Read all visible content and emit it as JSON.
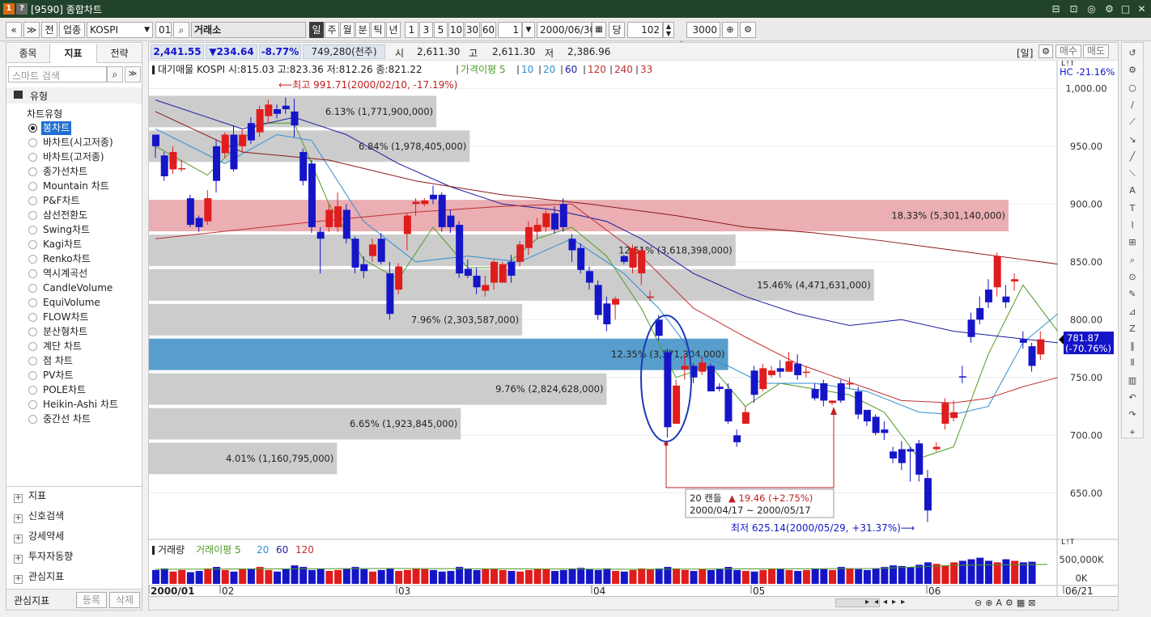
{
  "window": {
    "badge1": "1",
    "badge2": "?",
    "title": "[9590] 종합차트",
    "buttons": [
      "⊟",
      "⊡",
      "◎",
      "⚙",
      "□",
      "✕"
    ]
  },
  "toolbar": {
    "nav_prev": "«",
    "nav_down": "≫",
    "btn_prev": "전",
    "btn_industry": "업종",
    "symbol": "KOSPI",
    "code": "01",
    "market": "거래소",
    "periods": [
      "일",
      "주",
      "월",
      "분",
      "틱",
      "년"
    ],
    "active_period": "일",
    "intervals": [
      "1",
      "3",
      "5",
      "10",
      "30",
      "60"
    ],
    "count": "1",
    "date": "2000/06/30",
    "btn_dang": "당",
    "bars": "102",
    "slash": "/",
    "total": "3000"
  },
  "sidebar": {
    "tabs": [
      "종목",
      "지표",
      "전략"
    ],
    "active_tab": "지표",
    "search_placeholder": "스마트 검색",
    "group_title": "유형",
    "tree_title": "차트유형",
    "chart_types": [
      "봉차트",
      "바차트(시고저종)",
      "바차트(고저종)",
      "종가선차트",
      "Mountain 차트",
      "P&F차트",
      "삼선전환도",
      "Swing차트",
      "Kagi차트",
      "Renko차트",
      "역시계곡선",
      "CandleVolume",
      "EquiVolume",
      "FLOW차트",
      "분산형차트",
      "계단 차트",
      "점 차트",
      "PV차트",
      "POLE차트",
      "Heikin-Ashi 차트",
      "중간선 차트"
    ],
    "selected_type": "봉차트",
    "groups": [
      "지표",
      "신호검색",
      "강세약세",
      "투자자동향",
      "관심지표"
    ],
    "footer_label": "관심지표",
    "footer_register": "등록",
    "footer_delete": "삭제"
  },
  "pricebar": {
    "price": "2,441.55",
    "change": "▼234.64",
    "pct": "-8.77%",
    "volume": "749,280(천주)",
    "open_label": "시",
    "open": "2,611.30",
    "high_label": "고",
    "high": "2,611.30",
    "low_label": "저",
    "low": "2,386.96",
    "period_label": "[일]",
    "buy": "매수",
    "sell": "매도"
  },
  "legend": {
    "text": "대기매물 KOSPI 시:815.03 고:823.36 저:812.26 종:821.22",
    "ma_label": "가격이평 5",
    "ma10": "10",
    "ma20": "20",
    "ma60": "60",
    "ma120": "120",
    "ma240": "240",
    "ma33": "33"
  },
  "volume_legend": {
    "label": "거래량",
    "ma_label": "거래이평 5",
    "ma20": "20",
    "ma60": "60",
    "ma120": "120"
  },
  "annotations": {
    "high": "최고 991.71(2000/02/10, -17.19%)",
    "low": "최저 625.14(2000/05/29, +31.37%)",
    "range_title": "20 캔들",
    "range_change": "▲ 19.46 (+2.75%)",
    "range_dates": "2000/04/17 ~ 2000/05/17",
    "hc": "HC -21.16%",
    "current_price": "781.87",
    "current_pct": "(-70.76%)",
    "vol_ticks": [
      "500,000K",
      "0K"
    ],
    "lit1": "L!T",
    "lit2": "L!T"
  },
  "colors": {
    "up": "#e01c1c",
    "down": "#1515c8",
    "ma5": "#4f9a25",
    "ma10": "#2e8fd0",
    "ma20": "#1a1aa0",
    "ma60": "#8a1a1a",
    "ma120": "#c03030",
    "volume_profile_gray": "#c8c8c8",
    "volume_profile_red": "#e6a0a6",
    "volume_profile_blue": "#4a96c8"
  },
  "chart_data": {
    "type": "candlestick",
    "title": "KOSPI",
    "ylim": [
      610,
      1010
    ],
    "y_ticks": [
      "1,000.00",
      "950.00",
      "900.00",
      "850.00",
      "800.00",
      "750.00",
      "700.00",
      "650.00"
    ],
    "y_tick_values": [
      1000,
      950,
      900,
      850,
      800,
      750,
      700,
      650
    ],
    "x_labels": [
      "2000/01",
      "02",
      "03",
      "04",
      "05",
      "06",
      "06/21"
    ],
    "volume_profile": [
      {
        "lo": 965,
        "hi": 995,
        "label": "6.13% (1,771,900,000)",
        "value": 6.13
      },
      {
        "lo": 935,
        "hi": 965,
        "label": "6.84% (1,978,405,000)",
        "value": 6.84
      },
      {
        "lo": 905,
        "hi": 935,
        "label": "",
        "value": 0
      },
      {
        "lo": 875,
        "hi": 905,
        "label": "18.33% (5,301,140,000)",
        "value": 18.33
      },
      {
        "lo": 845,
        "hi": 875,
        "label": "12.51% (3,618,398,000)",
        "value": 12.51
      },
      {
        "lo": 815,
        "hi": 845,
        "label": "15.46% (4,471,631,000)",
        "value": 15.46
      },
      {
        "lo": 785,
        "hi": 815,
        "label": "7.96% (2,303,587,000)",
        "value": 7.96
      },
      {
        "lo": 755,
        "hi": 785,
        "label": "12.35% (3,571,304,000)",
        "value": 12.35
      },
      {
        "lo": 725,
        "hi": 755,
        "label": "9.76% (2,824,628,000)",
        "value": 9.76
      },
      {
        "lo": 695,
        "hi": 725,
        "label": "6.65% (1,923,845,000)",
        "value": 6.65
      },
      {
        "lo": 665,
        "hi": 695,
        "label": "4.01% (1,160,795,000)",
        "value": 4.01
      }
    ],
    "candles": [
      [
        960,
        950,
        960,
        940
      ],
      [
        942,
        924,
        945,
        920
      ],
      [
        930,
        945,
        950,
        926
      ],
      [
        930,
        931,
        938,
        928
      ],
      [
        905,
        882,
        908,
        880
      ],
      [
        888,
        880,
        890,
        876
      ],
      [
        885,
        905,
        912,
        882
      ],
      [
        950,
        920,
        955,
        910
      ],
      [
        944,
        960,
        962,
        940
      ],
      [
        960,
        930,
        968,
        928
      ],
      [
        950,
        960,
        965,
        945
      ],
      [
        970,
        955,
        975,
        952
      ],
      [
        962,
        982,
        985,
        958
      ],
      [
        976,
        986,
        990,
        970
      ],
      [
        982,
        978,
        986,
        974
      ],
      [
        985,
        982,
        992,
        978
      ],
      [
        980,
        968,
        991,
        958
      ],
      [
        945,
        920,
        948,
        916
      ],
      [
        935,
        880,
        938,
        875
      ],
      [
        876,
        870,
        880,
        840
      ],
      [
        880,
        895,
        900,
        876
      ],
      [
        880,
        898,
        910,
        876
      ],
      [
        895,
        870,
        900,
        866
      ],
      [
        870,
        845,
        872,
        840
      ],
      [
        848,
        842,
        855,
        836
      ],
      [
        855,
        865,
        870,
        850
      ],
      [
        870,
        850,
        875,
        848
      ],
      [
        840,
        805,
        850,
        800
      ],
      [
        826,
        846,
        849,
        822
      ],
      [
        874,
        890,
        892,
        860
      ],
      [
        900,
        902,
        905,
        890
      ],
      [
        900,
        903,
        905,
        898
      ],
      [
        908,
        904,
        916,
        900
      ],
      [
        908,
        880,
        910,
        876
      ],
      [
        890,
        880,
        895,
        875
      ],
      [
        882,
        840,
        885,
        836
      ],
      [
        844,
        838,
        852,
        836
      ],
      [
        838,
        828,
        845,
        822
      ],
      [
        825,
        830,
        838,
        820
      ],
      [
        832,
        850,
        852,
        826
      ],
      [
        832,
        848,
        850,
        836
      ],
      [
        850,
        838,
        856,
        832
      ],
      [
        850,
        865,
        868,
        846
      ],
      [
        862,
        880,
        885,
        856
      ],
      [
        876,
        882,
        888,
        870
      ],
      [
        880,
        892,
        895,
        876
      ],
      [
        892,
        878,
        898,
        874
      ],
      [
        900,
        880,
        905,
        876
      ],
      [
        870,
        860,
        874,
        850
      ],
      [
        862,
        843,
        866,
        840
      ],
      [
        842,
        832,
        846,
        826
      ],
      [
        830,
        804,
        834,
        800
      ],
      [
        814,
        796,
        820,
        790
      ],
      [
        813,
        818,
        820,
        800
      ],
      [
        855,
        850,
        856,
        848
      ],
      [
        845,
        862,
        865,
        840
      ],
      [
        840,
        860,
        862,
        830
      ],
      [
        820,
        820,
        825,
        816
      ],
      [
        800,
        786,
        804,
        782
      ],
      [
        772,
        707,
        775,
        698
      ],
      [
        710,
        743,
        748,
        730
      ],
      [
        757,
        760,
        770,
        748
      ],
      [
        760,
        750,
        762,
        745
      ],
      [
        755,
        763,
        768,
        752
      ],
      [
        760,
        738,
        762,
        740
      ],
      [
        742,
        740,
        745,
        738
      ],
      [
        740,
        712,
        745,
        710
      ],
      [
        700,
        694,
        705,
        690
      ],
      [
        710,
        720,
        725,
        712
      ],
      [
        756,
        735,
        760,
        728
      ],
      [
        740,
        758,
        762,
        738
      ],
      [
        752,
        756,
        760,
        750
      ],
      [
        758,
        755,
        765,
        750
      ],
      [
        755,
        764,
        772,
        755
      ],
      [
        762,
        752,
        770,
        748
      ],
      [
        755,
        755,
        760,
        750
      ],
      [
        740,
        732,
        745,
        730
      ],
      [
        745,
        730,
        748,
        725
      ],
      [
        728,
        730,
        730,
        726
      ],
      [
        745,
        730,
        748,
        728
      ],
      [
        745,
        745,
        750,
        740
      ],
      [
        738,
        718,
        742,
        714
      ],
      [
        722,
        712,
        720,
        708
      ],
      [
        716,
        702,
        718,
        700
      ],
      [
        705,
        702,
        712,
        696
      ],
      [
        686,
        680,
        690,
        676
      ],
      [
        688,
        676,
        695,
        670
      ],
      [
        688,
        686,
        690,
        660
      ],
      [
        693,
        666,
        696,
        660
      ],
      [
        663,
        635,
        670,
        625
      ],
      [
        688,
        690,
        694,
        686
      ],
      [
        710,
        728,
        732,
        705
      ],
      [
        715,
        720,
        730,
        712
      ],
      [
        751,
        750,
        760,
        745
      ],
      [
        800,
        785,
        806,
        780
      ],
      [
        810,
        800,
        820,
        796
      ],
      [
        826,
        815,
        835,
        810
      ],
      [
        828,
        855,
        858,
        820
      ],
      [
        820,
        815,
        830,
        810
      ],
      [
        833,
        835,
        840,
        825
      ],
      [
        783,
        780,
        790,
        775
      ],
      [
        777,
        760,
        780,
        755
      ],
      [
        770,
        783,
        790,
        765
      ]
    ],
    "volumes": [
      0.45,
      0.5,
      0.4,
      0.45,
      0.38,
      0.42,
      0.5,
      0.55,
      0.45,
      0.4,
      0.48,
      0.5,
      0.55,
      0.45,
      0.4,
      0.5,
      0.6,
      0.55,
      0.45,
      0.5,
      0.42,
      0.45,
      0.5,
      0.55,
      0.48,
      0.4,
      0.45,
      0.5,
      0.42,
      0.45,
      0.5,
      0.48,
      0.45,
      0.4,
      0.42,
      0.55,
      0.5,
      0.45,
      0.48,
      0.5,
      0.45,
      0.42,
      0.4,
      0.45,
      0.5,
      0.48,
      0.42,
      0.45,
      0.5,
      0.52,
      0.48,
      0.45,
      0.5,
      0.42,
      0.4,
      0.45,
      0.5,
      0.48,
      0.5,
      0.55,
      0.5,
      0.45,
      0.42,
      0.48,
      0.45,
      0.5,
      0.55,
      0.45,
      0.42,
      0.4,
      0.45,
      0.5,
      0.48,
      0.45,
      0.42,
      0.45,
      0.5,
      0.48,
      0.45,
      0.55,
      0.5,
      0.48,
      0.45,
      0.5,
      0.55,
      0.6,
      0.58,
      0.55,
      0.62,
      0.7,
      0.65,
      0.6,
      0.7,
      0.75,
      0.8,
      0.85,
      0.75,
      0.7,
      0.8,
      0.75,
      0.7,
      0.72
    ],
    "ma_series": [
      {
        "name": "5",
        "color": "#4f9a25",
        "points": [
          [
            0,
            950
          ],
          [
            6,
            925
          ],
          [
            12,
            970
          ],
          [
            16,
            970
          ],
          [
            20,
            900
          ],
          [
            24,
            852
          ],
          [
            28,
            835
          ],
          [
            32,
            880
          ],
          [
            36,
            845
          ],
          [
            40,
            845
          ],
          [
            44,
            870
          ],
          [
            48,
            880
          ],
          [
            52,
            855
          ],
          [
            56,
            810
          ],
          [
            60,
            750
          ],
          [
            64,
            760
          ],
          [
            68,
            725
          ],
          [
            72,
            745
          ],
          [
            76,
            740
          ],
          [
            80,
            735
          ],
          [
            84,
            720
          ],
          [
            88,
            680
          ],
          [
            92,
            690
          ],
          [
            96,
            770
          ],
          [
            100,
            830
          ],
          [
            104,
            790
          ]
        ]
      },
      {
        "name": "10",
        "color": "#2e8fd0",
        "points": [
          [
            0,
            965
          ],
          [
            8,
            935
          ],
          [
            14,
            960
          ],
          [
            18,
            955
          ],
          [
            24,
            885
          ],
          [
            30,
            850
          ],
          [
            36,
            855
          ],
          [
            42,
            850
          ],
          [
            48,
            870
          ],
          [
            54,
            840
          ],
          [
            58,
            810
          ],
          [
            62,
            770
          ],
          [
            66,
            760
          ],
          [
            70,
            745
          ],
          [
            76,
            745
          ],
          [
            82,
            738
          ],
          [
            88,
            720
          ],
          [
            92,
            718
          ],
          [
            96,
            725
          ],
          [
            100,
            780
          ],
          [
            104,
            805
          ]
        ]
      },
      {
        "name": "20",
        "color": "#1a1aa0",
        "points": [
          [
            0,
            990
          ],
          [
            10,
            965
          ],
          [
            16,
            975
          ],
          [
            22,
            960
          ],
          [
            28,
            935
          ],
          [
            34,
            915
          ],
          [
            40,
            900
          ],
          [
            46,
            895
          ],
          [
            52,
            885
          ],
          [
            56,
            870
          ],
          [
            62,
            840
          ],
          [
            68,
            820
          ],
          [
            74,
            805
          ],
          [
            80,
            795
          ],
          [
            86,
            800
          ],
          [
            92,
            790
          ],
          [
            98,
            785
          ],
          [
            104,
            780
          ]
        ]
      },
      {
        "name": "60",
        "color": "#8a1a1a",
        "points": [
          [
            0,
            980
          ],
          [
            10,
            945
          ],
          [
            20,
            938
          ],
          [
            30,
            920
          ],
          [
            40,
            908
          ],
          [
            50,
            900
          ],
          [
            60,
            890
          ],
          [
            68,
            880
          ],
          [
            76,
            875
          ],
          [
            84,
            868
          ],
          [
            92,
            860
          ],
          [
            100,
            852
          ],
          [
            104,
            848
          ]
        ]
      },
      {
        "name": "120",
        "color": "#c03030",
        "points": [
          [
            0,
            870
          ],
          [
            10,
            878
          ],
          [
            20,
            886
          ],
          [
            30,
            893
          ],
          [
            40,
            898
          ],
          [
            48,
            900
          ],
          [
            56,
            855
          ],
          [
            62,
            810
          ],
          [
            68,
            785
          ],
          [
            74,
            762
          ],
          [
            80,
            746
          ],
          [
            86,
            730
          ],
          [
            92,
            728
          ],
          [
            96,
            732
          ],
          [
            100,
            742
          ],
          [
            104,
            750
          ]
        ]
      }
    ]
  }
}
